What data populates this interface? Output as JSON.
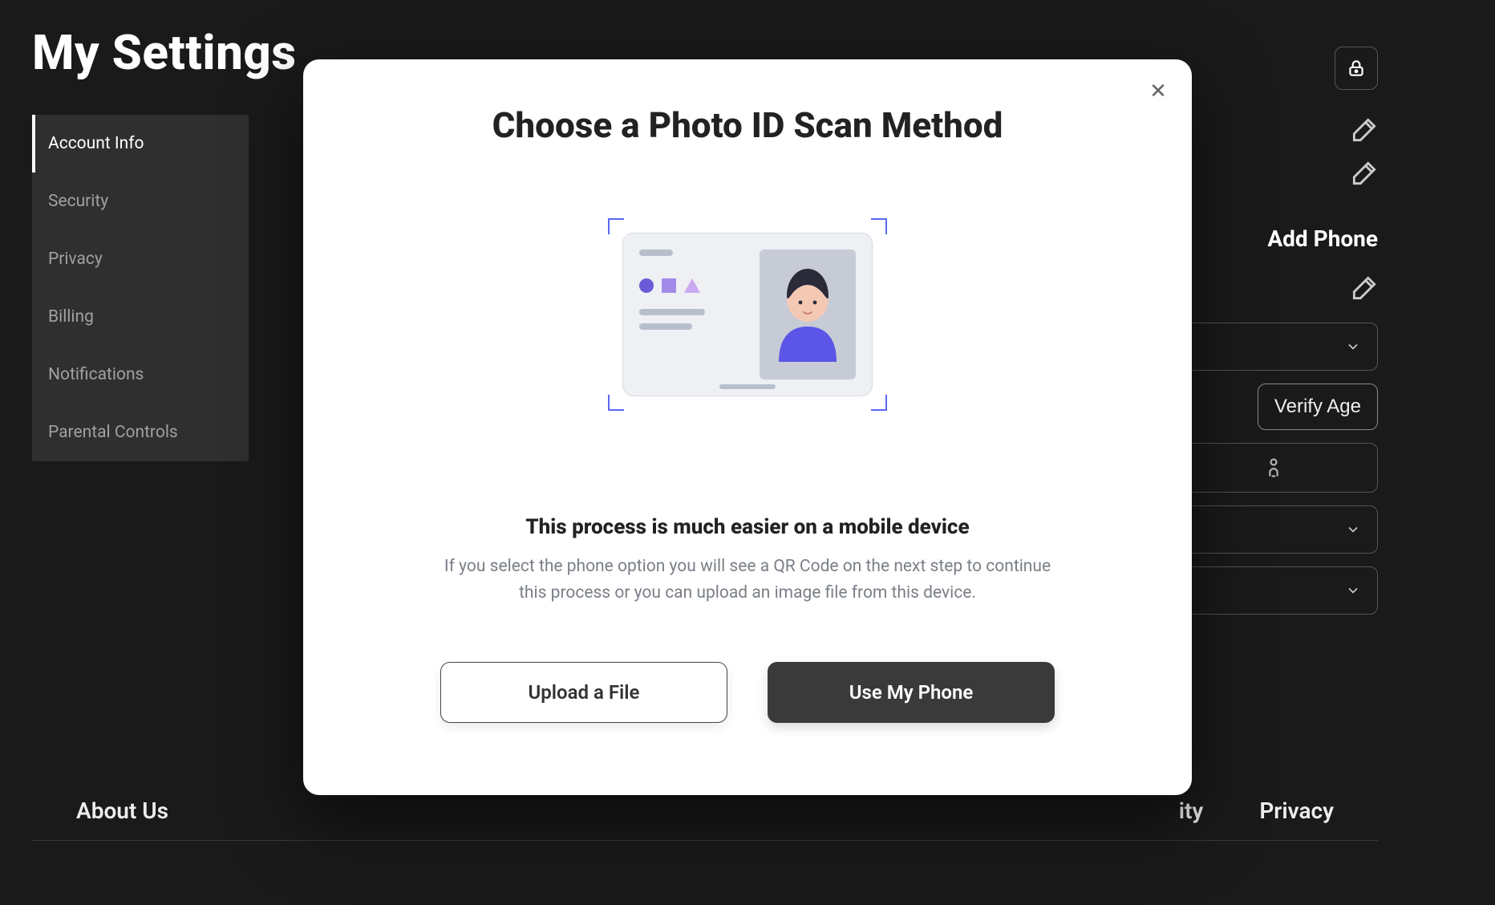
{
  "page": {
    "title": "My Settings"
  },
  "sidebar": {
    "items": [
      {
        "label": "Account Info",
        "active": true
      },
      {
        "label": "Security",
        "active": false
      },
      {
        "label": "Privacy",
        "active": false
      },
      {
        "label": "Billing",
        "active": false
      },
      {
        "label": "Notifications",
        "active": false
      },
      {
        "label": "Parental Controls",
        "active": false
      }
    ]
  },
  "right": {
    "add_phone_label": "Add Phone",
    "verify_age_label": "Verify Age"
  },
  "footer": {
    "about": "About Us",
    "accessibility_partial": "ity",
    "privacy": "Privacy"
  },
  "modal": {
    "title": "Choose a Photo ID Scan Method",
    "subtitle": "This process is much easier on a mobile device",
    "description": "If you select the phone option you will see a QR Code on the next step to continue this process or you can upload an image file from this device.",
    "upload_label": "Upload a File",
    "phone_label": "Use My Phone"
  }
}
